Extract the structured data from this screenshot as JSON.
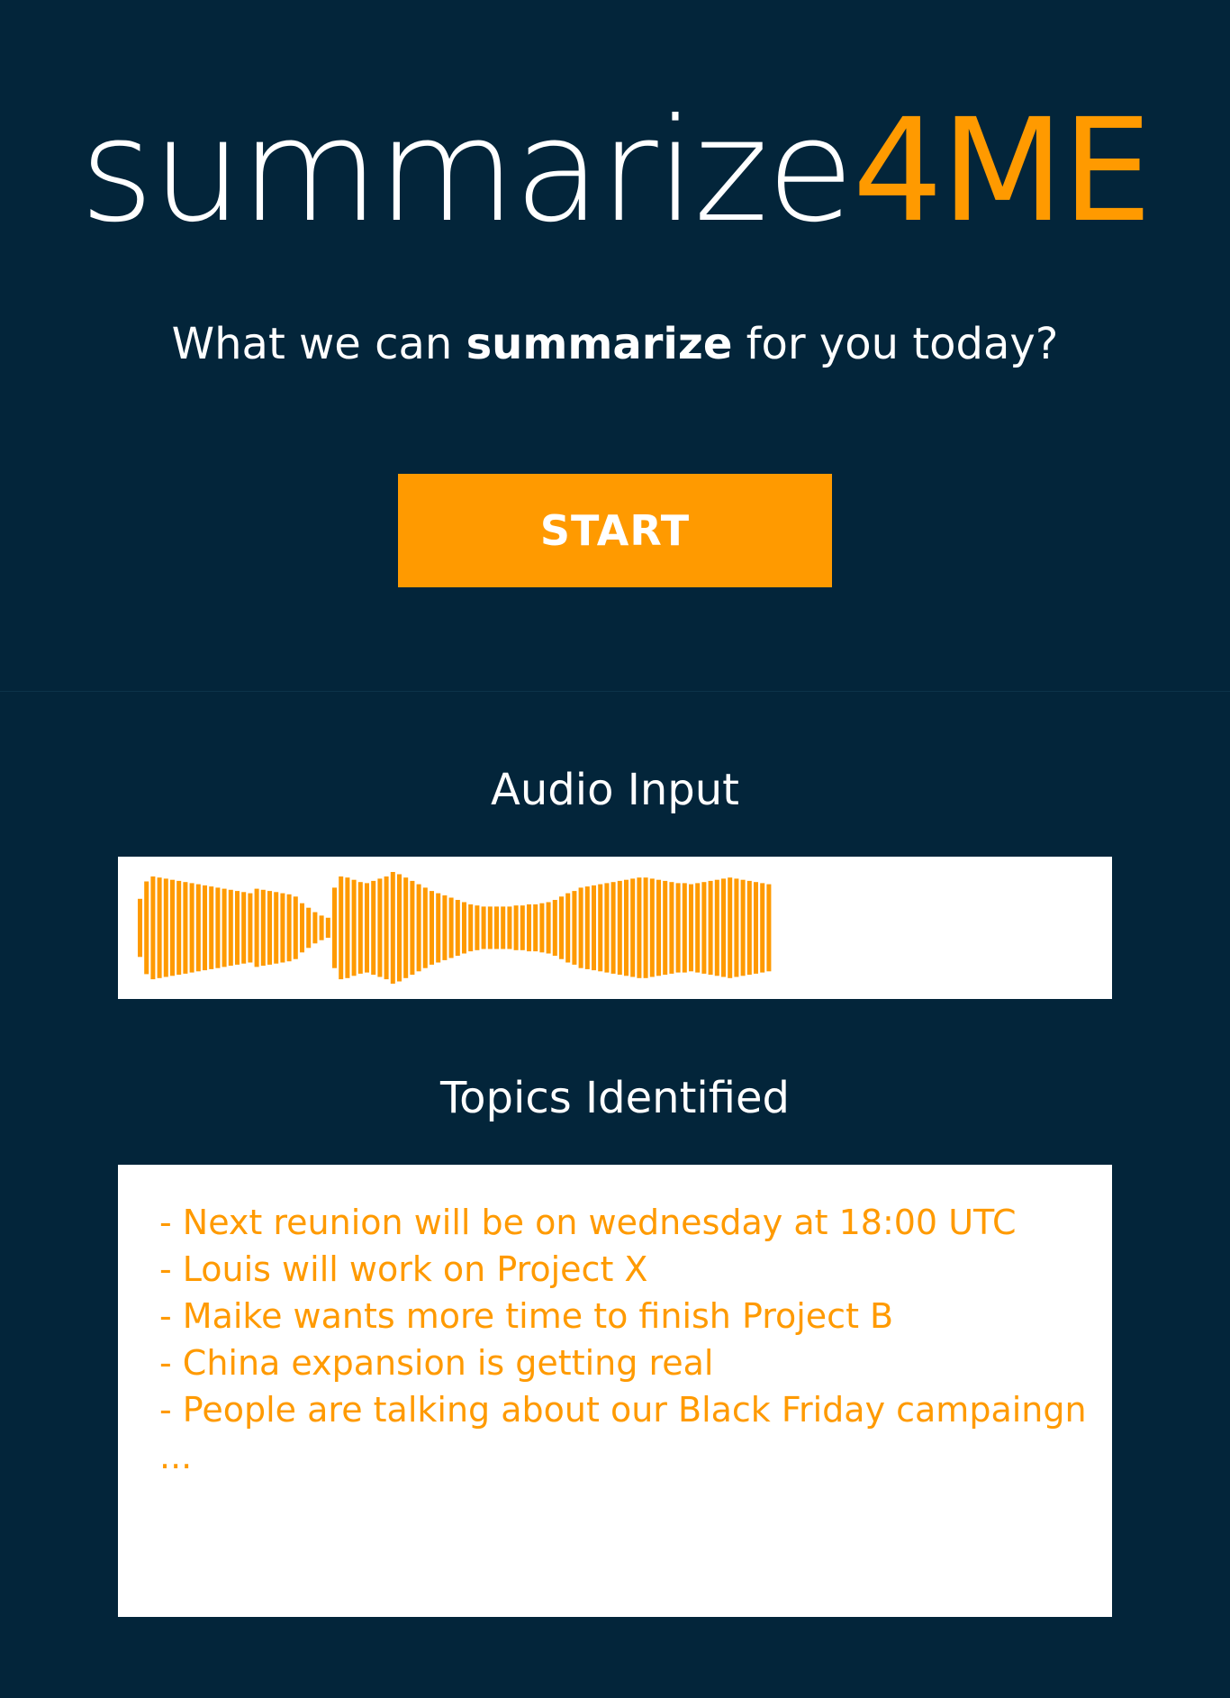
{
  "brand": {
    "logo_main": "summarize",
    "logo_accent": "4ME",
    "accent_color": "#ff9a00",
    "background_color": "#03253a"
  },
  "hero": {
    "question_prefix": "What we can",
    "question_bold": "summarize",
    "question_suffix": "for you today?",
    "start_label": "START"
  },
  "audio_input": {
    "heading": "Audio Input"
  },
  "topics": {
    "heading": "Topics Identified",
    "items": [
      "- Next reunion will be on wednesday at 18:00 UTC",
      "- Louis will work on Project X",
      "- Maike wants more time to finish Project B",
      "- China expansion is getting real",
      "- People are talking about our Black Friday campaingn",
      "..."
    ]
  }
}
